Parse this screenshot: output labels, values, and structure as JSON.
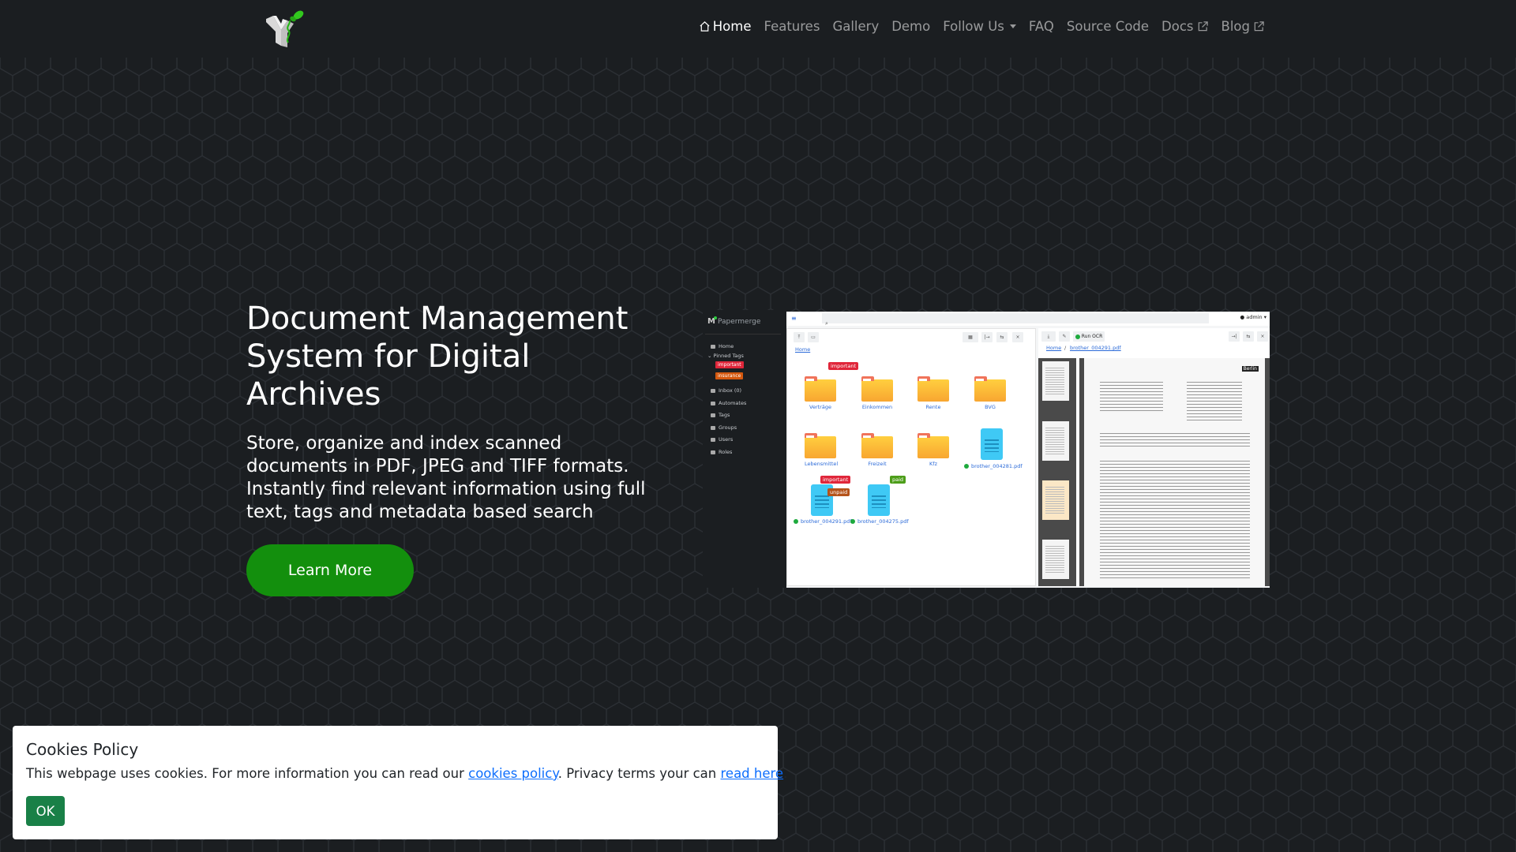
{
  "colors": {
    "background": "#1b1e21",
    "accent_green": "#138f0d",
    "cookie_ok": "#198047",
    "link": "#0d6efd"
  },
  "navbar": {
    "logo": "papermerge-logo",
    "links": [
      {
        "label": "Home",
        "icon": "home-icon",
        "active": true
      },
      {
        "label": "Features"
      },
      {
        "label": "Gallery"
      },
      {
        "label": "Demo"
      },
      {
        "label": "Follow Us",
        "dropdown": true
      },
      {
        "label": "FAQ"
      },
      {
        "label": "Source Code"
      },
      {
        "label": "Docs",
        "icon": "external-link-icon"
      },
      {
        "label": "Blog",
        "icon": "external-link-icon"
      }
    ]
  },
  "hero": {
    "title": "Document Management System for Digital Archives",
    "text": "Store, organize and index scanned documents in PDF, JPEG and TIFF formats. Instantly find relevant information using full text, tags and metadata based search",
    "cta": "Learn More"
  },
  "preview": {
    "brand": "Papermerge",
    "user": "admin",
    "sidebar": [
      {
        "label": "Home"
      },
      {
        "label": "Pinned Tags"
      },
      {
        "label": "Inbox (0)"
      },
      {
        "label": "Automates"
      },
      {
        "label": "Tags"
      },
      {
        "label": "Groups"
      },
      {
        "label": "Users"
      },
      {
        "label": "Roles"
      }
    ],
    "pinned_tags": [
      {
        "label": "important",
        "color": "#e0263a"
      },
      {
        "label": "insurance",
        "color": "#d4580e"
      }
    ],
    "breadcrumb_left": "Home",
    "breadcrumb_right": [
      "Home",
      "brother_004291.pdf"
    ],
    "run_ocr": "Run OCR",
    "folders": [
      "Verträge",
      "Einkommen",
      "Rente",
      "BVG",
      "Lebensmittel",
      "Freizeit",
      "Kfz"
    ],
    "documents": [
      "brother_004281.pdf",
      "brother_004291.pdf",
      "brother_004275.pdf"
    ],
    "tags": {
      "important": "important",
      "unpaid": "unpaid",
      "paid": "paid"
    },
    "doc_header": "Berlin"
  },
  "cookie": {
    "title": "Cookies Policy",
    "text_before": "This webpage uses cookies. For more information you can read our ",
    "link1": "cookies policy",
    "text_middle": ". Privacy terms your can ",
    "link2": "read here",
    "text_after": ".",
    "ok": "OK"
  }
}
